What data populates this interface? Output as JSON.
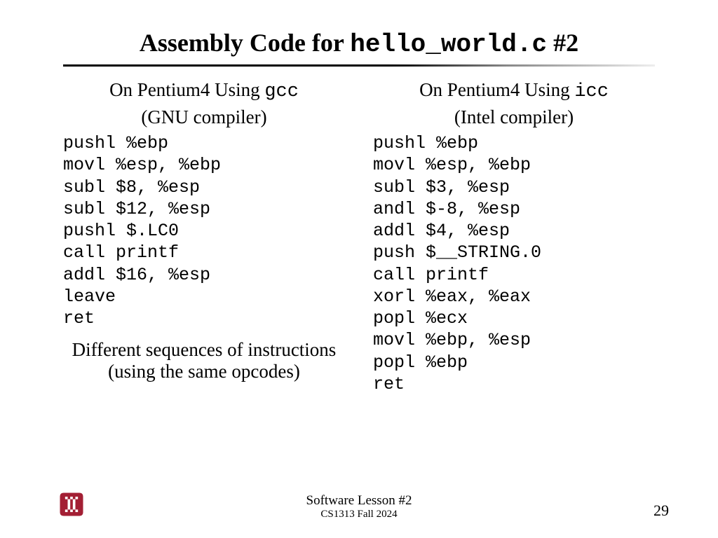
{
  "title": {
    "prefix": "Assembly Code for ",
    "mono": "hello_world.c",
    "suffix": " #2"
  },
  "left": {
    "heading_prefix": "On Pentium4 Using ",
    "heading_mono": "gcc",
    "paren": "(GNU compiler)",
    "code": "pushl %ebp\nmovl %esp, %ebp\nsubl $8, %esp\nsubl $12, %esp\npushl $.LC0\ncall printf\naddl $16, %esp\nleave\nret",
    "note": "Different sequences of instructions\n(using the same opcodes)"
  },
  "right": {
    "heading_prefix": "On Pentium4 Using ",
    "heading_mono": "icc",
    "paren": "(Intel compiler)",
    "code": "pushl %ebp\nmovl %esp, %ebp\nsubl $3, %esp\nandl $-8, %esp\naddl $4, %esp\npush $__STRING.0\ncall printf\nxorl %eax, %eax\npopl %ecx\nmovl %ebp, %esp\npopl %ebp\nret"
  },
  "footer": {
    "lesson": "Software Lesson #2",
    "course": "CS1313 Fall 2024",
    "page": "29",
    "logo_color": "#a31f34"
  }
}
